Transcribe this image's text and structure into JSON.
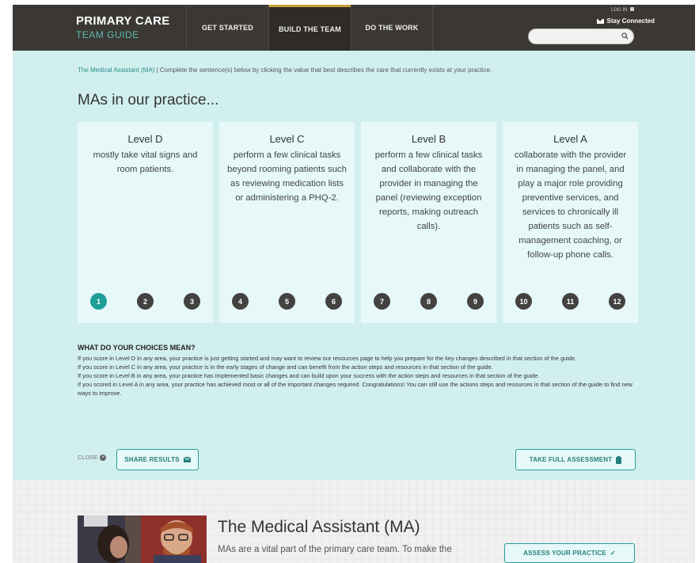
{
  "header": {
    "logo_line1": "PRIMARY CARE",
    "logo_line2": "TEAM GUIDE",
    "nav": [
      "GET STARTED",
      "BUILD THE TEAM",
      "DO THE WORK"
    ],
    "active_nav_index": 1,
    "login_label": "LOG IN",
    "stay_connected_label": "Stay Connected",
    "search_placeholder": ""
  },
  "assessment": {
    "intro_role": "The Medical Assistant (MA)",
    "intro_rest": " | Complete the sentence(s) below by clicking the value that best describes the care that currently exists at your practice.",
    "heading": "MAs in our practice...",
    "levels": [
      {
        "title": "Level D",
        "description": "mostly take vital signs and room patients.",
        "scores": [
          "1",
          "2",
          "3"
        ]
      },
      {
        "title": "Level C",
        "description": "perform a few clinical tasks beyond rooming patients such as reviewing medication lists or administering a PHQ-2.",
        "scores": [
          "4",
          "5",
          "6"
        ]
      },
      {
        "title": "Level B",
        "description": "perform a few clinical tasks and collaborate with the provider in managing the panel (reviewing exception reports, making outreach calls).",
        "scores": [
          "7",
          "8",
          "9"
        ]
      },
      {
        "title": "Level A",
        "description": "collaborate with the provider in managing the panel, and play a major role providing preventive services, and services to chronically ill patients such as self-management coaching, or follow-up phone calls.",
        "scores": [
          "10",
          "11",
          "12"
        ]
      }
    ],
    "selected_score": "1",
    "choices_title": "WHAT DO YOUR CHOICES MEAN?",
    "choices": [
      "If you score in Level D in any area, your practice is just getting started and may want to review our resources page to help you prepare for the key changes described in that section of the guide.",
      "If you score in Level C in any area, your practice is in the early stages of change and can benefit from the action steps and resources in that section of the guide.",
      "If you score in Level B in any area, your practice has implemented basic changes and can build upon your success with the action steps and resources in that section of the guide.",
      "If you scored in Level A in any area, your practice has achieved most or all of the important changes required. Congratulations! You can still use the actions steps and resources in that section of the guide to find new ways to improve."
    ],
    "close_label": "CLOSE",
    "share_label": "SHARE RESULTS",
    "full_assessment_label": "TAKE FULL ASSESSMENT"
  },
  "section": {
    "title": "The Medical Assistant (MA)",
    "description": "MAs are a vital part of the primary care team. To make the",
    "assess_label": "ASSESS YOUR PRACTICE"
  },
  "colors": {
    "header_bg": "#3b3834",
    "accent_teal": "#1e9e99",
    "panel_bg": "#d2efef",
    "active_tab_marker": "#caa23a"
  }
}
